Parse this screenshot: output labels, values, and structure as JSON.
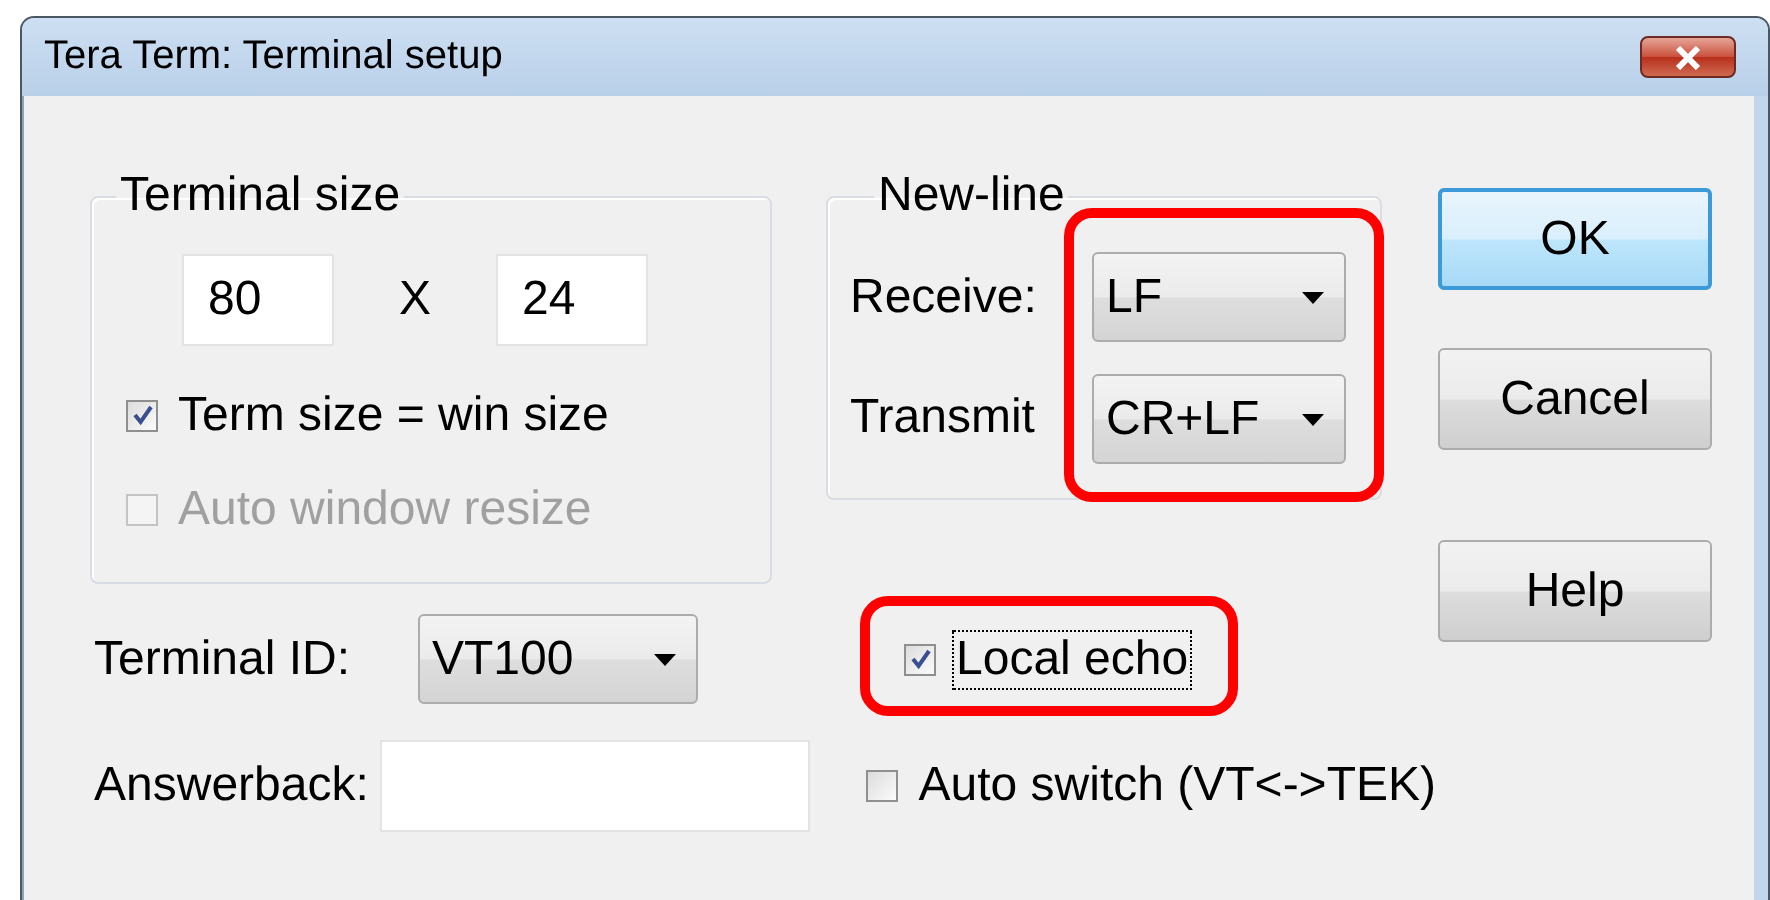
{
  "window": {
    "title": "Tera Term: Terminal setup"
  },
  "terminal_size": {
    "label": "Terminal size",
    "columns": "80",
    "separator": "X",
    "rows": "24",
    "options": [
      {
        "label": "Term size = win size",
        "checked": true,
        "disabled": false
      },
      {
        "label": "Auto window resize",
        "checked": false,
        "disabled": true
      }
    ]
  },
  "new_line": {
    "label": "New-line",
    "highlighted": true,
    "fields": [
      {
        "label": "Receive:",
        "value": "LF"
      },
      {
        "label": "Transmit",
        "value": "CR+LF"
      }
    ]
  },
  "terminal_id": {
    "label": "Terminal ID:",
    "value": "VT100"
  },
  "answerback": {
    "label": "Answerback:"
  },
  "local_echo": {
    "label": "Local echo",
    "checked": true,
    "focused": true,
    "highlighted": true
  },
  "auto_switch": {
    "label": "Auto switch (VT<->TEK)",
    "checked": false
  },
  "buttons": [
    {
      "label": "OK",
      "default": true
    },
    {
      "label": "Cancel",
      "default": false
    },
    {
      "label": "Help",
      "default": false
    }
  ]
}
